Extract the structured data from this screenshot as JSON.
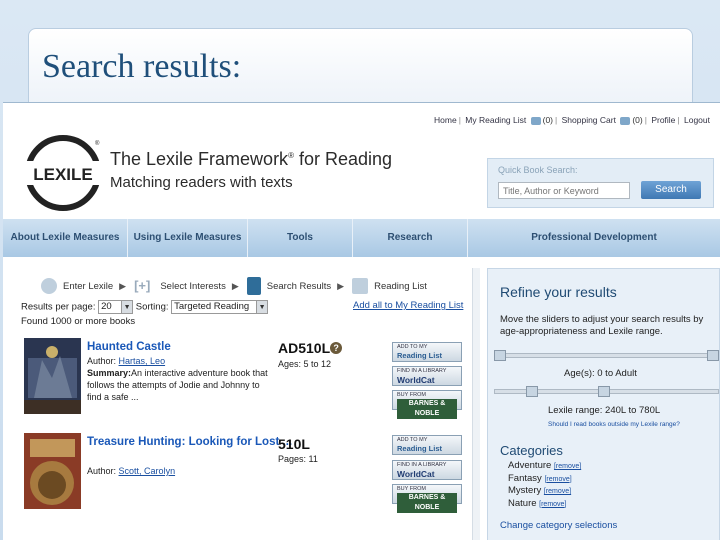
{
  "slide": {
    "title": "Search results:"
  },
  "toplinks": {
    "home": "Home",
    "reading_list": "My Reading List",
    "reading_count": "(0)",
    "cart": "Shopping Cart",
    "cart_count": "(0)",
    "profile": "Profile",
    "logout": "Logout"
  },
  "brand": {
    "logo_text": "LEXILE",
    "line1": "The Lexile Framework",
    "reg": "®",
    "line1b": " for Reading",
    "line2": "Matching readers with texts"
  },
  "quick_search": {
    "label": "Quick Book Search:",
    "placeholder": "Title, Author or Keyword",
    "button": "Search"
  },
  "nav": [
    {
      "label": "About Lexile Measures"
    },
    {
      "label": "Using Lexile Measures"
    },
    {
      "label": "Tools"
    },
    {
      "label": "Research"
    },
    {
      "label": "Professional Development"
    }
  ],
  "steps": [
    {
      "label": "Enter Lexile"
    },
    {
      "label": "Select Interests"
    },
    {
      "label": "Search Results"
    },
    {
      "label": "Reading List"
    }
  ],
  "controls": {
    "per_page_label": "Results per page:",
    "per_page_value": "20",
    "sorting_label": "Sorting:",
    "sorting_value": "Targeted Reading",
    "add_all": "Add all to My Reading List",
    "found": "Found 1000 or more books"
  },
  "results": [
    {
      "title": "Haunted Castle",
      "author_label": "Author:",
      "author": "Hartas, Leo",
      "summary_label": "Summary:",
      "summary": "An interactive adventure book that follows the attempts of Jodie and Johnny to find a safe ...",
      "lexile": "AD510L",
      "meta": "Ages: 5 to 12"
    },
    {
      "title": "Treasure Hunting: Looking for Lost",
      "title_suffix": " ...",
      "author_label": "Author:",
      "author": "Scott, Carolyn",
      "lexile": "510L",
      "meta": "Pages: 11"
    }
  ],
  "buttons": {
    "add_small": "ADD TO MY",
    "add_big": "Reading List",
    "library_small": "FIND IN A LIBRARY",
    "library_big": "WorldCat",
    "buy_small": "BUY FROM",
    "buy_big": "BARNES & NOBLE"
  },
  "refine": {
    "title": "Refine your results",
    "desc": "Move the sliders to adjust your search results by age-appropriateness and Lexile range.",
    "age": "Age(s): 0 to Adult",
    "lexile_range": "Lexile range: 240L to 780L",
    "outside": "Should I read books outside my Lexile range?",
    "categories_title": "Categories",
    "categories": [
      {
        "name": "Adventure",
        "remove": "[remove]"
      },
      {
        "name": "Fantasy",
        "remove": "[remove]"
      },
      {
        "name": "Mystery",
        "remove": "[remove]"
      },
      {
        "name": "Nature",
        "remove": "[remove]"
      }
    ],
    "change": "Change category selections"
  },
  "colors": {
    "accent": "#1f4a73",
    "link": "#1a58b8",
    "nav_text": "#2d4f72"
  }
}
